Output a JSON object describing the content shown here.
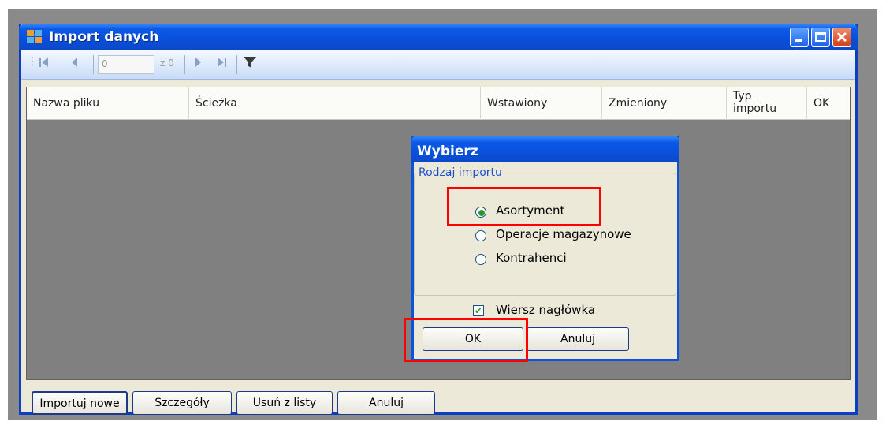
{
  "window": {
    "title": "Import danych"
  },
  "toolbar": {
    "position_value": "0",
    "count_label": "z 0"
  },
  "grid": {
    "columns": [
      "Nazwa pliku",
      "Ścieżka",
      "Wstawiony",
      "Zmieniony",
      "Typ\nimportu",
      "OK"
    ]
  },
  "bottom_buttons": [
    "Importuj nowe",
    "Szczegóły",
    "Usuń z listy",
    "Anuluj"
  ],
  "dialog": {
    "title": "Wybierz",
    "group_label": "Rodzaj importu",
    "options": [
      "Asortyment",
      "Operacje magazynowe",
      "Kontrahenci"
    ],
    "selected_option": "Asortyment",
    "checkbox_label": "Wiersz nagłówka",
    "checkbox_checked": true,
    "ok_label": "OK",
    "cancel_label": "Anuluj"
  },
  "colors": {
    "titlebar": "#0a4fd9",
    "highlight": "#ff0000",
    "radio_selected": "#2a9a2a"
  }
}
